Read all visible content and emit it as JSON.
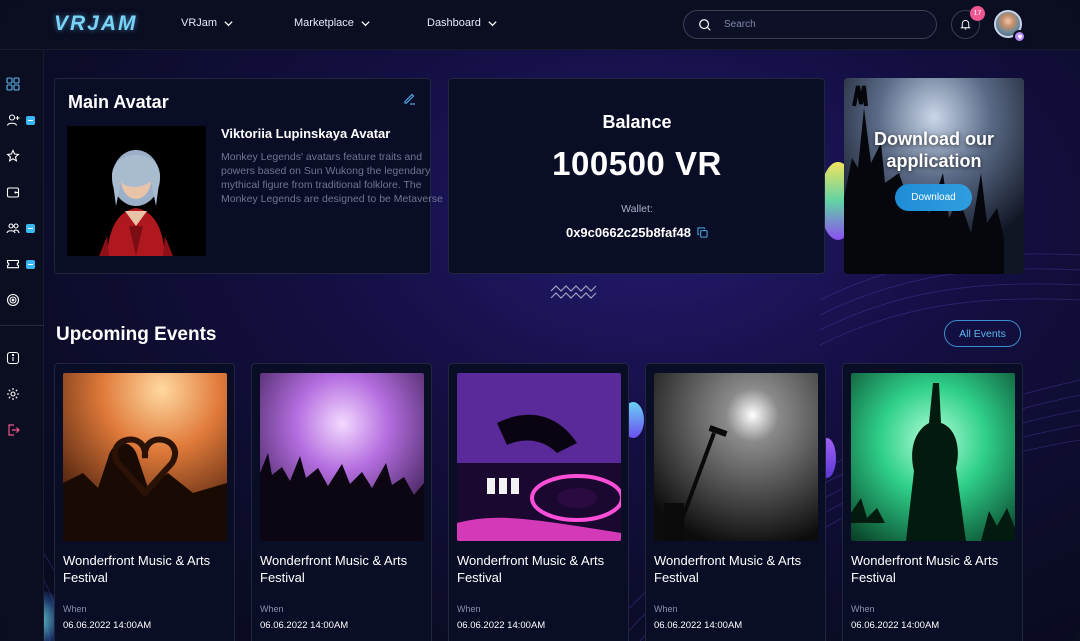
{
  "header": {
    "logo": "VRJAM",
    "nav": [
      {
        "label": "VRJam"
      },
      {
        "label": "Marketplace"
      },
      {
        "label": "Dashboard"
      }
    ],
    "search_placeholder": "Search",
    "notification_count": "17"
  },
  "sidebar": {
    "icons": [
      "grid-icon",
      "add-user-icon",
      "star-icon",
      "wallet-icon",
      "users-icon",
      "ticket-icon",
      "broadcast-icon",
      "info-icon",
      "settings-icon",
      "logout-icon"
    ]
  },
  "main_avatar": {
    "title": "Main Avatar",
    "name": "Viktoriia Lupinskaya Avatar",
    "description": "Monkey Legends' avatars feature traits and powers based on Sun Wukong the legendary mythical figure from traditional folklore. The Monkey Legends are designed to be Metaverse"
  },
  "balance": {
    "title": "Balance",
    "amount": "100500 VR",
    "wallet_label": "Wallet:",
    "wallet_address": "0x9c0662c25b8faf48"
  },
  "download": {
    "title": "Download our application",
    "button": "Download"
  },
  "events": {
    "title": "Upcoming Events",
    "all_button": "All Events",
    "items": [
      {
        "title": "Wonderfront Music & Arts Festival",
        "when_label": "When",
        "date": "06.06.2022  14:00AM"
      },
      {
        "title": "Wonderfront Music & Arts Festival",
        "when_label": "When",
        "date": "06.06.2022  14:00AM"
      },
      {
        "title": "Wonderfront Music & Arts Festival",
        "when_label": "When",
        "date": "06.06.2022  14:00AM"
      },
      {
        "title": "Wonderfront Music & Arts Festival",
        "when_label": "When",
        "date": "06.06.2022  14:00AM"
      },
      {
        "title": "Wonderfront Music & Arts Festival",
        "when_label": "When",
        "date": "06.06.2022  14:00AM"
      }
    ]
  },
  "colors": {
    "accent": "#39b7f2",
    "badge": "#f0568f",
    "background": "#0b0d20"
  }
}
